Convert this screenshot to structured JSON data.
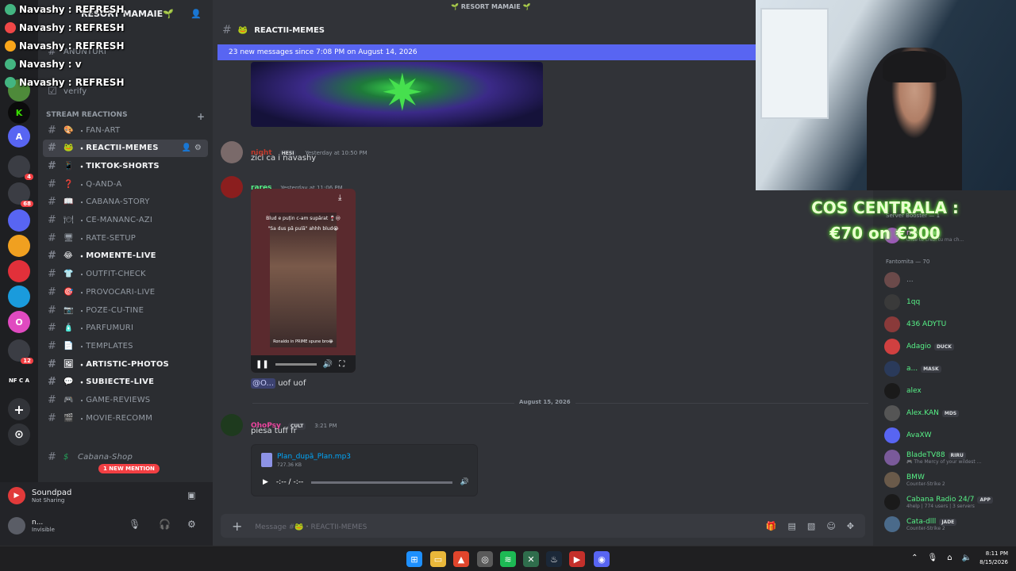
{
  "window": {
    "title": "🌱 RESORT MAMAIE 🌱"
  },
  "overlay_chat": [
    {
      "text": "Navashy : REFRESH"
    },
    {
      "text": "Navashy : REFRESH"
    },
    {
      "text": "Navashy : REFRESH"
    },
    {
      "text": "Navashy : v"
    },
    {
      "text": "Navashy : REFRESH"
    }
  ],
  "server": {
    "name": "RESORT MAMAIE🌱"
  },
  "sidebar": {
    "top_channels": [
      {
        "label": "ANUNTURI"
      },
      {
        "label": "verify"
      }
    ],
    "category": {
      "label": "STREAM REACTIONS"
    },
    "channels": [
      {
        "label": "FAN-ART",
        "emoji": "🎨"
      },
      {
        "label": "REACTII-MEMES",
        "emoji": "🐸"
      },
      {
        "label": "TIKTOK-SHORTS",
        "emoji": "📱"
      },
      {
        "label": "Q-AND-A",
        "emoji": "❓"
      },
      {
        "label": "CABANA-STORY",
        "emoji": "📖"
      },
      {
        "label": "CE-MANANC-AZI",
        "emoji": "🍽"
      },
      {
        "label": "RATE-SETUP",
        "emoji": "🖥"
      },
      {
        "label": "MOMENTE-LIVE",
        "emoji": "😂"
      },
      {
        "label": "OUTFIT-CHECK",
        "emoji": "👕"
      },
      {
        "label": "PROVOCARI-LIVE",
        "emoji": "🎯"
      },
      {
        "label": "POZE-CU-TINE",
        "emoji": "📷"
      },
      {
        "label": "PARFUMURI",
        "emoji": "🧴"
      },
      {
        "label": "TEMPLATES",
        "emoji": "📄"
      },
      {
        "label": "ARTISTIC-PHOTOS",
        "emoji": "🖼"
      },
      {
        "label": "SUBIECTE-LIVE",
        "emoji": "💬"
      },
      {
        "label": "GAME-REVIEWS",
        "emoji": "🎮"
      },
      {
        "label": "MOVIE-RECOMM",
        "emoji": "🎬"
      }
    ],
    "shop_channel": {
      "label": "Cabana-Shop",
      "emoji": "$"
    },
    "mention_pill": "1 NEW MENTION"
  },
  "user_panel": {
    "activity_title": "Soundpad",
    "activity_sub": "Not Sharing",
    "username": "n...",
    "status": "Invisible"
  },
  "channel_header": {
    "name": "REACTII-MEMES"
  },
  "new_messages_bar": "23 new messages since 7:08 PM on August 14, 2026",
  "messages": [
    {
      "author": "night",
      "tag": "HESI",
      "time": "Yesterday at 10:50 PM",
      "text": "zici ca i navashy",
      "color": "#c0392b"
    },
    {
      "author": "rares",
      "time": "Yesterday at 11:06 PM",
      "color": "#57f287",
      "video_caption_top": "Blud e puțin c-am supărat 🍷😒",
      "video_caption_sub": "\"Sa dus pă pulă\" ahhh blud😭",
      "video_caption_bottom": "Ronaldo in PRIME spune bro😂",
      "reply_mention": "@O...",
      "reply_text": "uof uof"
    },
    {
      "author": "OhoPsy",
      "tag": "CULT",
      "time": "3:21 PM",
      "text": "piesa tuff fr",
      "color": "#eb459e",
      "attachment_name": "Plan_după_Plan.mp3",
      "attachment_size": "727.36 KB",
      "player_time": "-:-- / -:--"
    }
  ],
  "date_divider": "August 15, 2026",
  "composer": {
    "placeholder": "Message #🐸・REACTII-MEMES"
  },
  "stream_overlay": {
    "line1": "COS CENTRALA :",
    "line2": "€70 on €300"
  },
  "member_list": {
    "groups": [
      {
        "label": "Server Booster — 1"
      },
      {
        "label": "Fantomita — 70"
      }
    ],
    "booster": {
      "name": "me",
      "tag": "VOID",
      "sub": "ulise te crezi tu ma ch..."
    },
    "members": [
      {
        "name": "...",
        "color": "#949ba4"
      },
      {
        "name": "1qq",
        "color": "#57f287"
      },
      {
        "name": "436 ADYTU",
        "color": "#57f287"
      },
      {
        "name": "Adagio",
        "tag": "DUCK",
        "color": "#57f287"
      },
      {
        "name": "a...",
        "tag": "MASK",
        "color": "#57f287"
      },
      {
        "name": "alex",
        "color": "#57f287"
      },
      {
        "name": "Alex.KAN",
        "tag": "MDS",
        "color": "#57f287"
      },
      {
        "name": "AvaXW",
        "color": "#57f287"
      },
      {
        "name": "BladeTV88",
        "tag": "RIRU",
        "sub": "🎮 The Mercy of your wildest ...",
        "color": "#57f287"
      },
      {
        "name": "BMW",
        "sub": "Counter-Strike 2",
        "color": "#57f287"
      },
      {
        "name": "Cabana Radio 24/7",
        "tag": "APP",
        "sub": "4help | 774 users | 3 servers",
        "color": "#57f287"
      },
      {
        "name": "Cata-dlll",
        "tag": "JADE",
        "sub": "Counter-Strike 2",
        "color": "#57f287"
      }
    ]
  },
  "taskbar": {
    "time": "8:11 PM",
    "date": "8/15/2026"
  }
}
